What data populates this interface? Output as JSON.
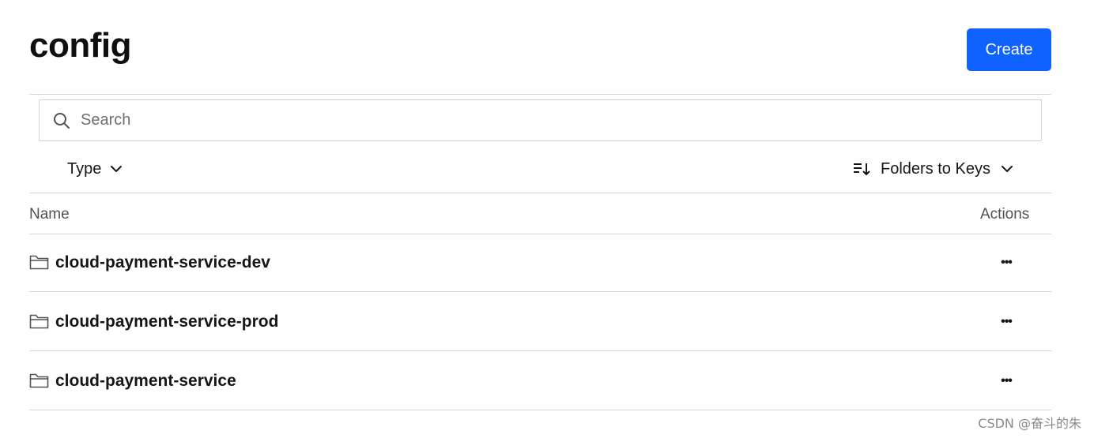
{
  "header": {
    "title": "config",
    "create_label": "Create"
  },
  "search": {
    "placeholder": "Search",
    "value": ""
  },
  "filters": {
    "type_label": "Type",
    "sort_label": "Folders to Keys"
  },
  "table": {
    "columns": [
      "Name",
      "Actions"
    ],
    "rows": [
      {
        "name": "cloud-payment-service-dev",
        "icon": "folder-icon",
        "actions": "•••"
      },
      {
        "name": "cloud-payment-service-prod",
        "icon": "folder-icon",
        "actions": "•••"
      },
      {
        "name": "cloud-payment-service",
        "icon": "folder-icon",
        "actions": "•••"
      }
    ]
  },
  "watermark": "CSDN @奋斗的朱",
  "colors": {
    "accent": "#0f62fe",
    "divider": "#d6d6d6",
    "muted_text": "#525252"
  }
}
